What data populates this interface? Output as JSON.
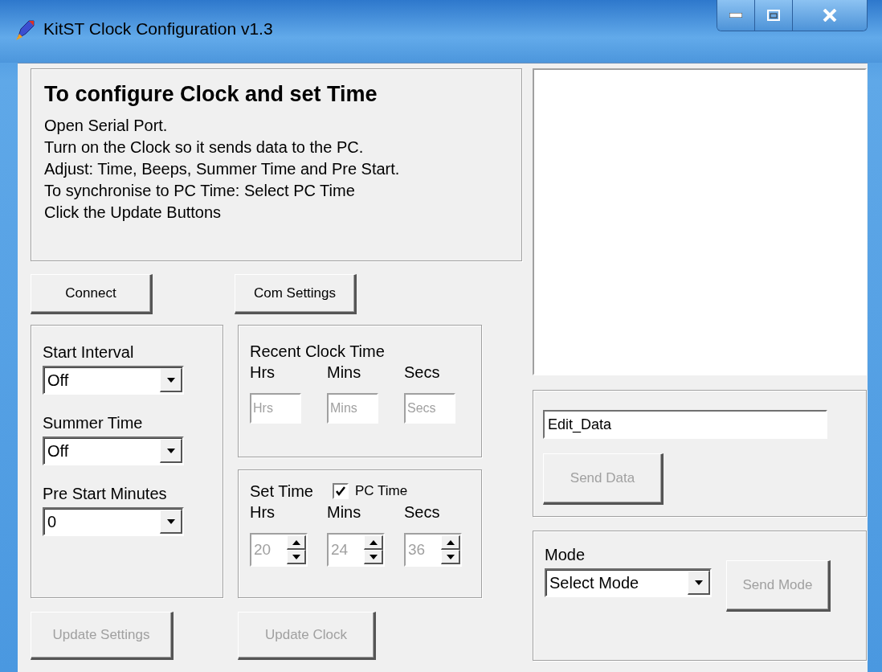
{
  "window": {
    "title": "KitST Clock Configuration v1.3"
  },
  "instructions": {
    "heading": "To configure Clock and set Time",
    "lines": [
      "Open Serial Port.",
      "Turn on the Clock so it sends data to the PC.",
      "Adjust: Time, Beeps, Summer Time and Pre Start.",
      "To synchronise to PC Time: Select PC Time",
      "Click the Update Buttons"
    ]
  },
  "top_buttons": [
    {
      "label": "Connect",
      "disabled": false
    },
    {
      "label": "Com Settings",
      "disabled": false
    }
  ],
  "settings": [
    {
      "label": "Start Interval",
      "value": "Off"
    },
    {
      "label": "Summer Time",
      "value": "Off"
    },
    {
      "label": "Pre Start Minutes",
      "value": "0"
    }
  ],
  "recent_clock_time": {
    "title": "Recent Clock Time",
    "columns": [
      "Hrs",
      "Mins",
      "Secs"
    ],
    "fields": [
      {
        "placeholder": "Hrs"
      },
      {
        "placeholder": "Mins"
      },
      {
        "placeholder": "Secs"
      }
    ]
  },
  "set_time": {
    "title": "Set Time",
    "pc_time": {
      "label": "PC Time",
      "checked": true
    },
    "columns": [
      "Hrs",
      "Mins",
      "Secs"
    ],
    "spinners": [
      {
        "value": "20",
        "disabled": true
      },
      {
        "value": "24",
        "disabled": true
      },
      {
        "value": "36",
        "disabled": true
      }
    ]
  },
  "bottom_buttons": [
    {
      "label": "Update Settings",
      "disabled": true
    },
    {
      "label": "Update Clock",
      "disabled": true
    }
  ],
  "data": {
    "field": {
      "value": "Edit_Data"
    },
    "send_button": {
      "label": "Send Data",
      "disabled": true
    }
  },
  "mode": {
    "label": "Mode",
    "value": "Select Mode",
    "send_button": {
      "label": "Send Mode",
      "disabled": true
    }
  }
}
